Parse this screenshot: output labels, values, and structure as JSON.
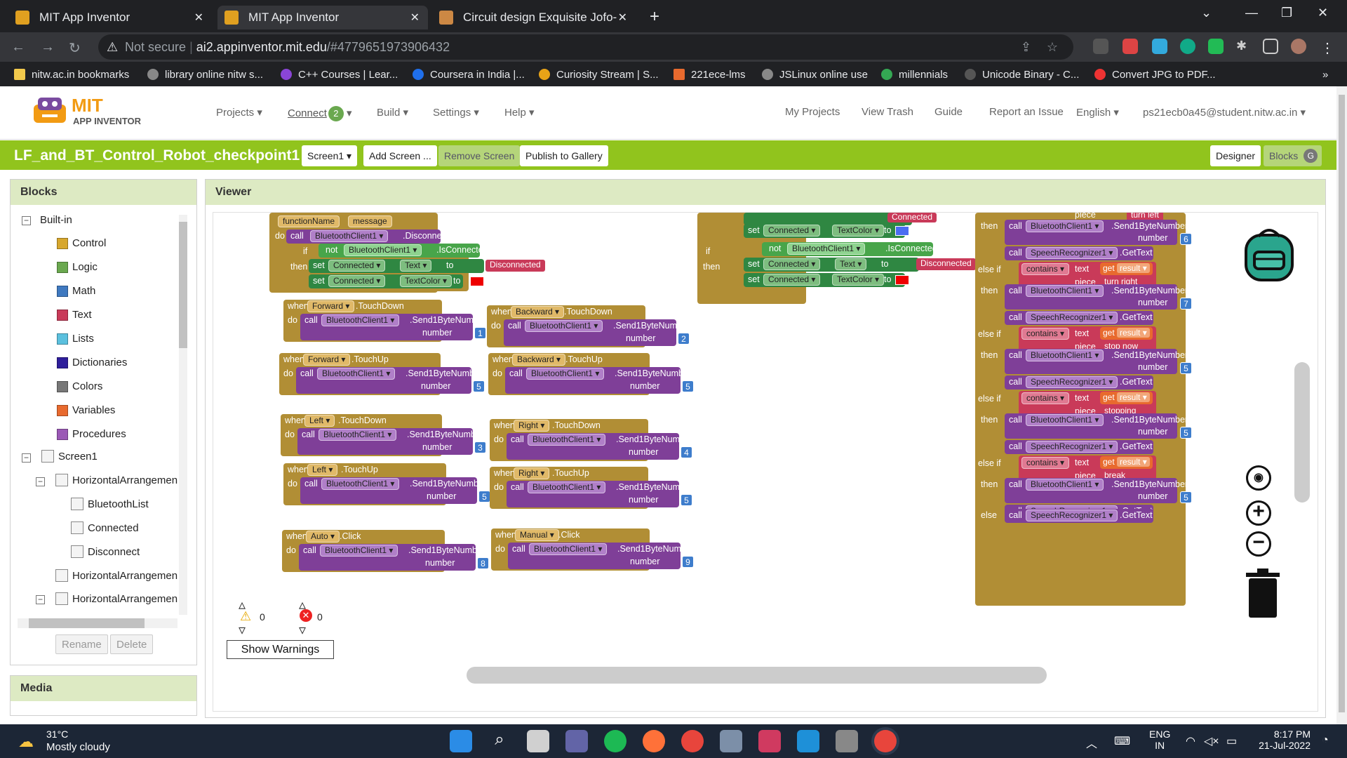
{
  "browser": {
    "tabs": [
      {
        "title": "MIT App Inventor",
        "active": false
      },
      {
        "title": "MIT App Inventor",
        "active": true
      },
      {
        "title": "Circuit design Exquisite Jofo-Mig",
        "active": false
      }
    ],
    "url_security": "Not secure",
    "url_domain": "ai2.appinventor.mit.edu",
    "url_path": "/#4779651973906432",
    "bookmarks": [
      "nitw.ac.in bookmarks",
      "library online nitw s...",
      "C++ Courses | Lear...",
      "Coursera in India |...",
      "Curiosity Stream | S...",
      "221ece-lms",
      "JSLinux online use",
      "millennials",
      "Unicode Binary - C...",
      "Convert JPG to PDF..."
    ],
    "bookmark_overflow": "»"
  },
  "app": {
    "logo_line1": "MIT",
    "logo_line2": "APP INVENTOR",
    "menu": [
      "Projects ▾",
      "Connect",
      "Build ▾",
      "Settings ▾",
      "Help ▾"
    ],
    "connect_badge": "2",
    "right_links": [
      "My Projects",
      "View Trash",
      "Guide",
      "Report an Issue",
      "English ▾",
      "ps21ecb0a45@student.nitw.ac.in ▾"
    ],
    "project_title": "LF_and_BT_Control_Robot_checkpoint1",
    "screen_select": "Screen1 ▾",
    "add_screen": "Add Screen ...",
    "remove_screen": "Remove Screen",
    "publish": "Publish to Gallery",
    "designer": "Designer",
    "blocks_btn": "Blocks",
    "blocks_avatar": "G"
  },
  "sidebar": {
    "header": "Blocks",
    "builtin": "Built-in",
    "categories": [
      {
        "label": "Control",
        "color": "#d7a72d"
      },
      {
        "label": "Logic",
        "color": "#6aa84f"
      },
      {
        "label": "Math",
        "color": "#3f79c0"
      },
      {
        "label": "Text",
        "color": "#c93a59"
      },
      {
        "label": "Lists",
        "color": "#5bc0de"
      },
      {
        "label": "Dictionaries",
        "color": "#2e1e9b"
      },
      {
        "label": "Colors",
        "color": "#777777"
      },
      {
        "label": "Variables",
        "color": "#e86a2e"
      },
      {
        "label": "Procedures",
        "color": "#9b59b6"
      }
    ],
    "screen": "Screen1",
    "components": [
      "HorizontalArrangemen",
      "BluetoothList",
      "Connected",
      "Disconnect",
      "HorizontalArrangemen",
      "HorizontalArrangemen"
    ],
    "rename": "Rename",
    "delete": "Delete",
    "media": "Media"
  },
  "viewer": {
    "header": "Viewer",
    "warn_count": "0",
    "error_count": "0",
    "show_warnings": "Show Warnings",
    "kw": {
      "when": "when",
      "do": "do",
      "call": "call",
      "set": "set",
      "to": "to",
      "if": "if",
      "then": "then",
      "not": "not",
      "number": "number",
      "else_if": "else if",
      "else": "else",
      "contains": "contains",
      "text": "text",
      "piece": "piece",
      "get": "get",
      "result": "result"
    },
    "comps": {
      "bt": "BluetoothClient1 ▾",
      "send": ".Send1ByteNumber",
      "disconnect": ".Disconnect",
      "isconnected": ".IsConnected",
      "connected": "Connected ▾",
      "text_prop": "Text ▾",
      "textcolor": "TextColor ▾",
      "speech": "SpeechRecognizer1 ▾",
      "gettext": ".GetText",
      "function_name": "functionName",
      "message": "message"
    },
    "strings": {
      "disconnected": "Disconnected",
      "connected": "Connected",
      "turn_left": "turn left",
      "turn_right": "turn right",
      "stop_now": "stop now",
      "stopping": "stopping",
      "break": "break"
    },
    "events": [
      {
        "comp": "Forward ▾",
        "event": ".TouchDown",
        "num": "1"
      },
      {
        "comp": "Forward ▾",
        "event": ".TouchUp",
        "num": "5"
      },
      {
        "comp": "Left ▾",
        "event": ".TouchDown",
        "num": "3"
      },
      {
        "comp": "Left ▾",
        "event": ".TouchUp",
        "num": "5"
      },
      {
        "comp": "Auto ▾",
        "event": ".Click",
        "num": "8"
      },
      {
        "comp": "Backward ▾",
        "event": ".TouchDown",
        "num": "2"
      },
      {
        "comp": "Backward ▾",
        "event": ".TouchUp",
        "num": "5"
      },
      {
        "comp": "Right ▾",
        "event": ".TouchDown",
        "num": "4"
      },
      {
        "comp": "Right ▾",
        "event": ".TouchUp",
        "num": "5"
      },
      {
        "comp": "Manual ▾",
        "event": ".Click",
        "num": "9"
      }
    ],
    "speech_numbers": [
      "6",
      "7",
      "5",
      "5",
      "5"
    ]
  },
  "taskbar": {
    "temp": "31°C",
    "weather": "Mostly cloudy",
    "lang1": "ENG",
    "lang2": "IN",
    "time": "8:17 PM",
    "date": "21-Jul-2022"
  }
}
